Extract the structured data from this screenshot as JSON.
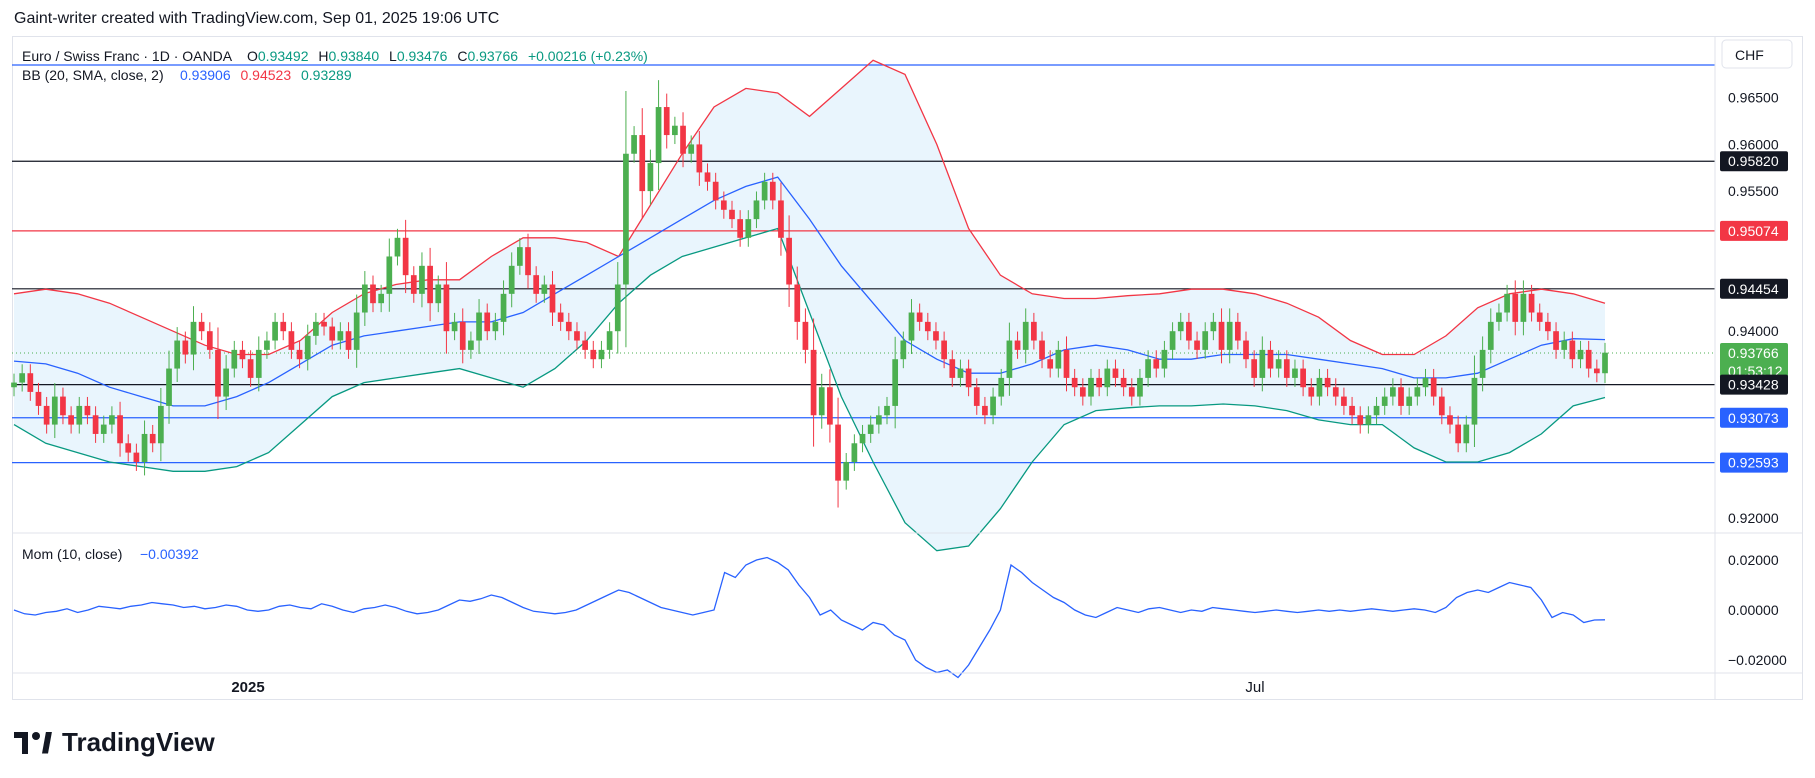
{
  "header": {
    "text": "Gaint-writer created with TradingView.com, Sep 01, 2025 19:06 UTC"
  },
  "legend": {
    "symbol": "Euro / Swiss Franc · 1D · OANDA",
    "o_label": "O",
    "o_value": "0.93492",
    "h_label": "H",
    "h_value": "0.93840",
    "l_label": "L",
    "l_value": "0.93476",
    "c_label": "C",
    "c_value": "0.93766",
    "change": "+0.00216 (+0.23%)",
    "bb_label": "BB (20, SMA, close, 2)",
    "bb_basis": "0.93906",
    "bb_upper": "0.94523",
    "bb_lower": "0.93289",
    "mom_label": "Mom (10, close)",
    "mom_value": "−0.00392"
  },
  "currency_button": "CHF",
  "brand": {
    "name": "TradingView"
  },
  "colors": {
    "up": "#4caf50",
    "down": "#f23645",
    "bb_basis": "#2962ff",
    "bb_upper": "#f23645",
    "bb_lower": "#089981",
    "bb_fill": "#e3f2fd",
    "momentum": "#2962ff",
    "line_black": "#131722",
    "line_pink": "#f23645",
    "line_blue": "#2962ff"
  },
  "price_axis": {
    "labels": [
      "0.96500",
      "0.96000",
      "0.95500",
      "0.94000",
      "0.92000"
    ]
  },
  "price_tags": [
    {
      "text": "0.95820",
      "bg": "#131722"
    },
    {
      "text": "0.95074",
      "bg": "#f23645"
    },
    {
      "text": "0.94454",
      "bg": "#131722"
    },
    {
      "text": "0.93766",
      "sub": "01:53:12",
      "bg": "#4caf50"
    },
    {
      "text": "0.93428",
      "bg": "#131722"
    },
    {
      "text": "0.93073",
      "bg": "#2962ff"
    },
    {
      "text": "0.92593",
      "bg": "#2962ff"
    }
  ],
  "mom_axis": {
    "labels": [
      "0.02000",
      "0.00000",
      "−0.02000"
    ]
  },
  "time_axis": {
    "labels": [
      "2025",
      "Jul"
    ]
  },
  "chart_data": {
    "type": "candlestick",
    "symbol": "Euro / Swiss Franc",
    "timeframe": "1D",
    "y_range": [
      0.9185,
      0.9715
    ],
    "horizontal_lines": [
      {
        "price": 0.9685,
        "color": "#2962ff"
      },
      {
        "price": 0.9582,
        "color": "#131722"
      },
      {
        "price": 0.95074,
        "color": "#f23645"
      },
      {
        "price": 0.94454,
        "color": "#131722"
      },
      {
        "price": 0.93428,
        "color": "#131722"
      },
      {
        "price": 0.93073,
        "color": "#2962ff"
      },
      {
        "price": 0.92593,
        "color": "#2962ff"
      }
    ],
    "last_close_line": 0.93766,
    "candles_close": [
      0.9345,
      0.9355,
      0.9335,
      0.932,
      0.93,
      0.933,
      0.931,
      0.93,
      0.932,
      0.931,
      0.929,
      0.93,
      0.931,
      0.928,
      0.927,
      0.926,
      0.929,
      0.928,
      0.932,
      0.936,
      0.939,
      0.9375,
      0.941,
      0.94,
      0.938,
      0.933,
      0.936,
      0.938,
      0.937,
      0.935,
      0.938,
      0.939,
      0.941,
      0.94,
      0.938,
      0.937,
      0.9395,
      0.941,
      0.9405,
      0.939,
      0.94,
      0.938,
      0.942,
      0.945,
      0.943,
      0.944,
      0.948,
      0.95,
      0.946,
      0.944,
      0.947,
      0.943,
      0.945,
      0.94,
      0.941,
      0.938,
      0.939,
      0.942,
      0.94,
      0.941,
      0.944,
      0.947,
      0.949,
      0.946,
      0.944,
      0.945,
      0.942,
      0.941,
      0.94,
      0.939,
      0.938,
      0.937,
      0.938,
      0.94,
      0.945,
      0.959,
      0.961,
      0.955,
      0.958,
      0.964,
      0.961,
      0.962,
      0.959,
      0.96,
      0.957,
      0.956,
      0.954,
      0.953,
      0.952,
      0.95,
      0.952,
      0.954,
      0.956,
      0.954,
      0.95,
      0.945,
      0.941,
      0.938,
      0.931,
      0.934,
      0.93,
      0.924,
      0.926,
      0.928,
      0.929,
      0.93,
      0.931,
      0.932,
      0.937,
      0.939,
      0.942,
      0.941,
      0.94,
      0.939,
      0.937,
      0.935,
      0.936,
      0.934,
      0.932,
      0.931,
      0.933,
      0.935,
      0.939,
      0.938,
      0.941,
      0.939,
      0.937,
      0.936,
      0.938,
      0.935,
      0.934,
      0.933,
      0.935,
      0.934,
      0.936,
      0.935,
      0.934,
      0.933,
      0.935,
      0.937,
      0.936,
      0.938,
      0.94,
      0.941,
      0.939,
      0.938,
      0.94,
      0.941,
      0.938,
      0.941,
      0.939,
      0.937,
      0.935,
      0.938,
      0.936,
      0.937,
      0.935,
      0.936,
      0.934,
      0.933,
      0.935,
      0.934,
      0.933,
      0.932,
      0.931,
      0.93,
      0.931,
      0.932,
      0.933,
      0.934,
      0.932,
      0.933,
      0.934,
      0.935,
      0.933,
      0.931,
      0.93,
      0.928,
      0.93,
      0.935,
      0.938,
      0.941,
      0.942,
      0.944,
      0.941,
      0.944,
      0.942,
      0.941,
      0.94,
      0.938,
      0.939,
      0.937,
      0.938,
      0.936,
      0.9355,
      0.9377
    ],
    "bb_upper": [
      0.944,
      0.9445,
      0.944,
      0.943,
      0.9415,
      0.94,
      0.9385,
      0.9375,
      0.9375,
      0.939,
      0.942,
      0.944,
      0.945,
      0.9455,
      0.9455,
      0.948,
      0.95,
      0.95,
      0.9495,
      0.948,
      0.9535,
      0.959,
      0.964,
      0.966,
      0.9655,
      0.963,
      0.966,
      0.969,
      0.9675,
      0.96,
      0.951,
      0.946,
      0.944,
      0.9435,
      0.9435,
      0.9438,
      0.944,
      0.9445,
      0.9445,
      0.944,
      0.943,
      0.9415,
      0.939,
      0.9375,
      0.9375,
      0.9395,
      0.9425,
      0.944,
      0.9445,
      0.944,
      0.943
    ],
    "bb_basis": [
      0.9368,
      0.9365,
      0.9355,
      0.934,
      0.933,
      0.932,
      0.932,
      0.933,
      0.9345,
      0.9365,
      0.9385,
      0.9395,
      0.94,
      0.9405,
      0.941,
      0.941,
      0.942,
      0.944,
      0.946,
      0.948,
      0.95,
      0.952,
      0.954,
      0.9555,
      0.9565,
      0.952,
      0.947,
      0.943,
      0.939,
      0.937,
      0.9355,
      0.9355,
      0.9365,
      0.938,
      0.9385,
      0.938,
      0.937,
      0.937,
      0.9375,
      0.9375,
      0.9375,
      0.937,
      0.9365,
      0.936,
      0.935,
      0.935,
      0.9355,
      0.937,
      0.9385,
      0.9392,
      0.9391
    ],
    "bb_lower": [
      0.93,
      0.928,
      0.927,
      0.926,
      0.9255,
      0.925,
      0.925,
      0.9255,
      0.927,
      0.93,
      0.933,
      0.9345,
      0.935,
      0.9355,
      0.936,
      0.935,
      0.934,
      0.936,
      0.939,
      0.943,
      0.946,
      0.948,
      0.949,
      0.95,
      0.951,
      0.942,
      0.933,
      0.926,
      0.9195,
      0.9165,
      0.917,
      0.921,
      0.926,
      0.93,
      0.9315,
      0.9318,
      0.932,
      0.932,
      0.9322,
      0.932,
      0.9315,
      0.9305,
      0.93,
      0.93,
      0.9275,
      0.926,
      0.926,
      0.927,
      0.929,
      0.932,
      0.9329
    ],
    "momentum": [
      0.0,
      -0.0015,
      -0.002,
      -0.001,
      -0.0005,
      0.0005,
      -0.001,
      0.0,
      0.0015,
      0.001,
      0.0005,
      0.0015,
      0.002,
      0.003,
      0.0025,
      0.002,
      0.001,
      0.0015,
      0.0005,
      0.001,
      0.002,
      0.0015,
      0.0,
      -0.0005,
      0.0,
      0.0015,
      0.002,
      0.001,
      0.0005,
      0.0025,
      0.0015,
      0.0,
      -0.001,
      0.0005,
      0.001,
      0.002,
      0.001,
      -0.0005,
      -0.0015,
      -0.001,
      0.0,
      0.002,
      0.004,
      0.0035,
      0.0045,
      0.006,
      0.005,
      0.003,
      0.001,
      -0.0005,
      -0.001,
      -0.0015,
      -0.001,
      0.0,
      0.002,
      0.004,
      0.006,
      0.008,
      0.007,
      0.005,
      0.003,
      0.001,
      0.0,
      -0.001,
      -0.002,
      -0.001,
      0.0,
      0.015,
      0.013,
      0.018,
      0.02,
      0.021,
      0.019,
      0.016,
      0.01,
      0.005,
      -0.002,
      0.0,
      -0.004,
      -0.006,
      -0.008,
      -0.005,
      -0.006,
      -0.01,
      -0.012,
      -0.02,
      -0.023,
      -0.025,
      -0.024,
      -0.027,
      -0.022,
      -0.015,
      -0.008,
      0.0,
      0.018,
      0.015,
      0.011,
      0.008,
      0.005,
      0.003,
      0.0,
      -0.002,
      -0.003,
      -0.001,
      0.001,
      0.0,
      -0.001,
      0.0005,
      0.001,
      0.0,
      -0.001,
      0.0,
      -0.0005,
      0.001,
      0.0005,
      0.0,
      -0.0005,
      -0.001,
      -0.0005,
      0.0,
      -0.0005,
      -0.001,
      -0.0005,
      0.0,
      -0.0005,
      0.0,
      -0.0005,
      0.0,
      0.0005,
      0.0,
      -0.0005,
      0.0,
      0.0005,
      0.0,
      -0.001,
      0.001,
      0.005,
      0.007,
      0.008,
      0.007,
      0.009,
      0.011,
      0.01,
      0.009,
      0.004,
      -0.003,
      -0.001,
      -0.002,
      -0.005,
      -0.004,
      -0.0039
    ]
  }
}
